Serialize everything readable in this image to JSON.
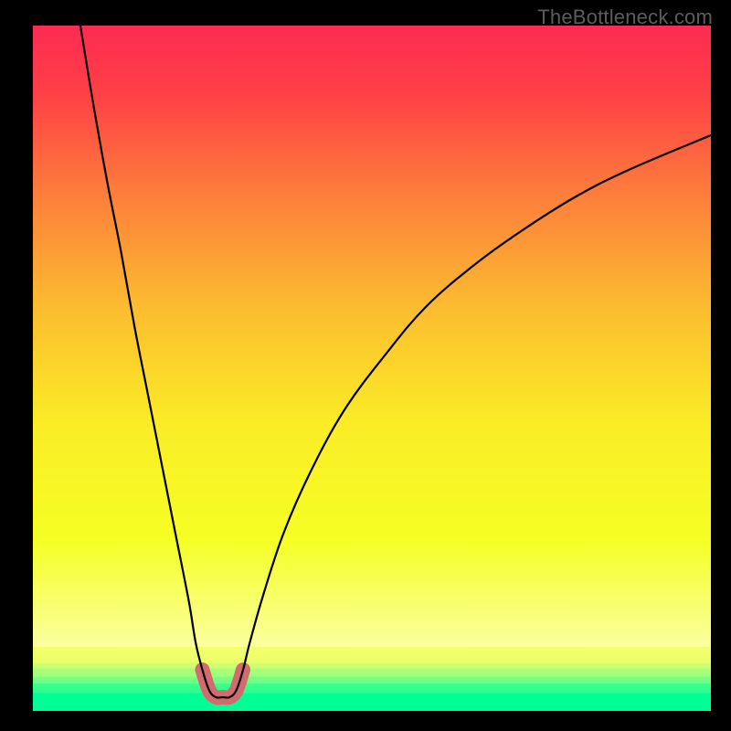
{
  "watermark": "TheBottleneck.com",
  "chart_data": {
    "type": "line",
    "title": "",
    "xlabel": "",
    "ylabel": "",
    "xlim": [
      0,
      100
    ],
    "ylim": [
      0,
      100
    ],
    "curve": {
      "name": "bottleneck-curve",
      "points": [
        {
          "x": 7,
          "y": 100
        },
        {
          "x": 9,
          "y": 88
        },
        {
          "x": 11,
          "y": 77
        },
        {
          "x": 13,
          "y": 67
        },
        {
          "x": 15,
          "y": 56
        },
        {
          "x": 17,
          "y": 46
        },
        {
          "x": 19,
          "y": 36
        },
        {
          "x": 21,
          "y": 26
        },
        {
          "x": 23,
          "y": 16
        },
        {
          "x": 24,
          "y": 10
        },
        {
          "x": 25,
          "y": 6
        },
        {
          "x": 26,
          "y": 3
        },
        {
          "x": 27,
          "y": 2
        },
        {
          "x": 28,
          "y": 2
        },
        {
          "x": 29,
          "y": 2
        },
        {
          "x": 30,
          "y": 3
        },
        {
          "x": 31,
          "y": 6
        },
        {
          "x": 32,
          "y": 10
        },
        {
          "x": 34,
          "y": 17
        },
        {
          "x": 37,
          "y": 26
        },
        {
          "x": 41,
          "y": 35
        },
        {
          "x": 46,
          "y": 44
        },
        {
          "x": 52,
          "y": 52
        },
        {
          "x": 58,
          "y": 59
        },
        {
          "x": 65,
          "y": 65
        },
        {
          "x": 72,
          "y": 70
        },
        {
          "x": 80,
          "y": 75
        },
        {
          "x": 88,
          "y": 79
        },
        {
          "x": 100,
          "y": 84
        }
      ]
    },
    "highlight_band": {
      "color": "#d36a6e",
      "x_range": [
        24.5,
        31.5
      ],
      "y_max": 9
    },
    "gradient_stops": [
      {
        "pos": 0.0,
        "color": "#fe2b53"
      },
      {
        "pos": 0.1,
        "color": "#fe4046"
      },
      {
        "pos": 0.25,
        "color": "#fd7f3b"
      },
      {
        "pos": 0.42,
        "color": "#fcbf2f"
      },
      {
        "pos": 0.58,
        "color": "#fbec26"
      },
      {
        "pos": 0.75,
        "color": "#f5ff24"
      },
      {
        "pos": 0.906,
        "color": "#fbffa0"
      },
      {
        "pos": 0.907,
        "color": "#f5ff6c"
      },
      {
        "pos": 0.93,
        "color": "#eaff6a"
      },
      {
        "pos": 0.9305,
        "color": "#d0ff70"
      },
      {
        "pos": 0.938,
        "color": "#c8ff73"
      },
      {
        "pos": 0.9385,
        "color": "#aaff78"
      },
      {
        "pos": 0.95,
        "color": "#9dff7c"
      },
      {
        "pos": 0.9505,
        "color": "#7cff82"
      },
      {
        "pos": 0.96,
        "color": "#67fe87"
      },
      {
        "pos": 0.9605,
        "color": "#3efe8c"
      },
      {
        "pos": 0.974,
        "color": "#28fe91"
      },
      {
        "pos": 0.9745,
        "color": "#00fe97"
      },
      {
        "pos": 1.0,
        "color": "#00fe97"
      }
    ]
  }
}
